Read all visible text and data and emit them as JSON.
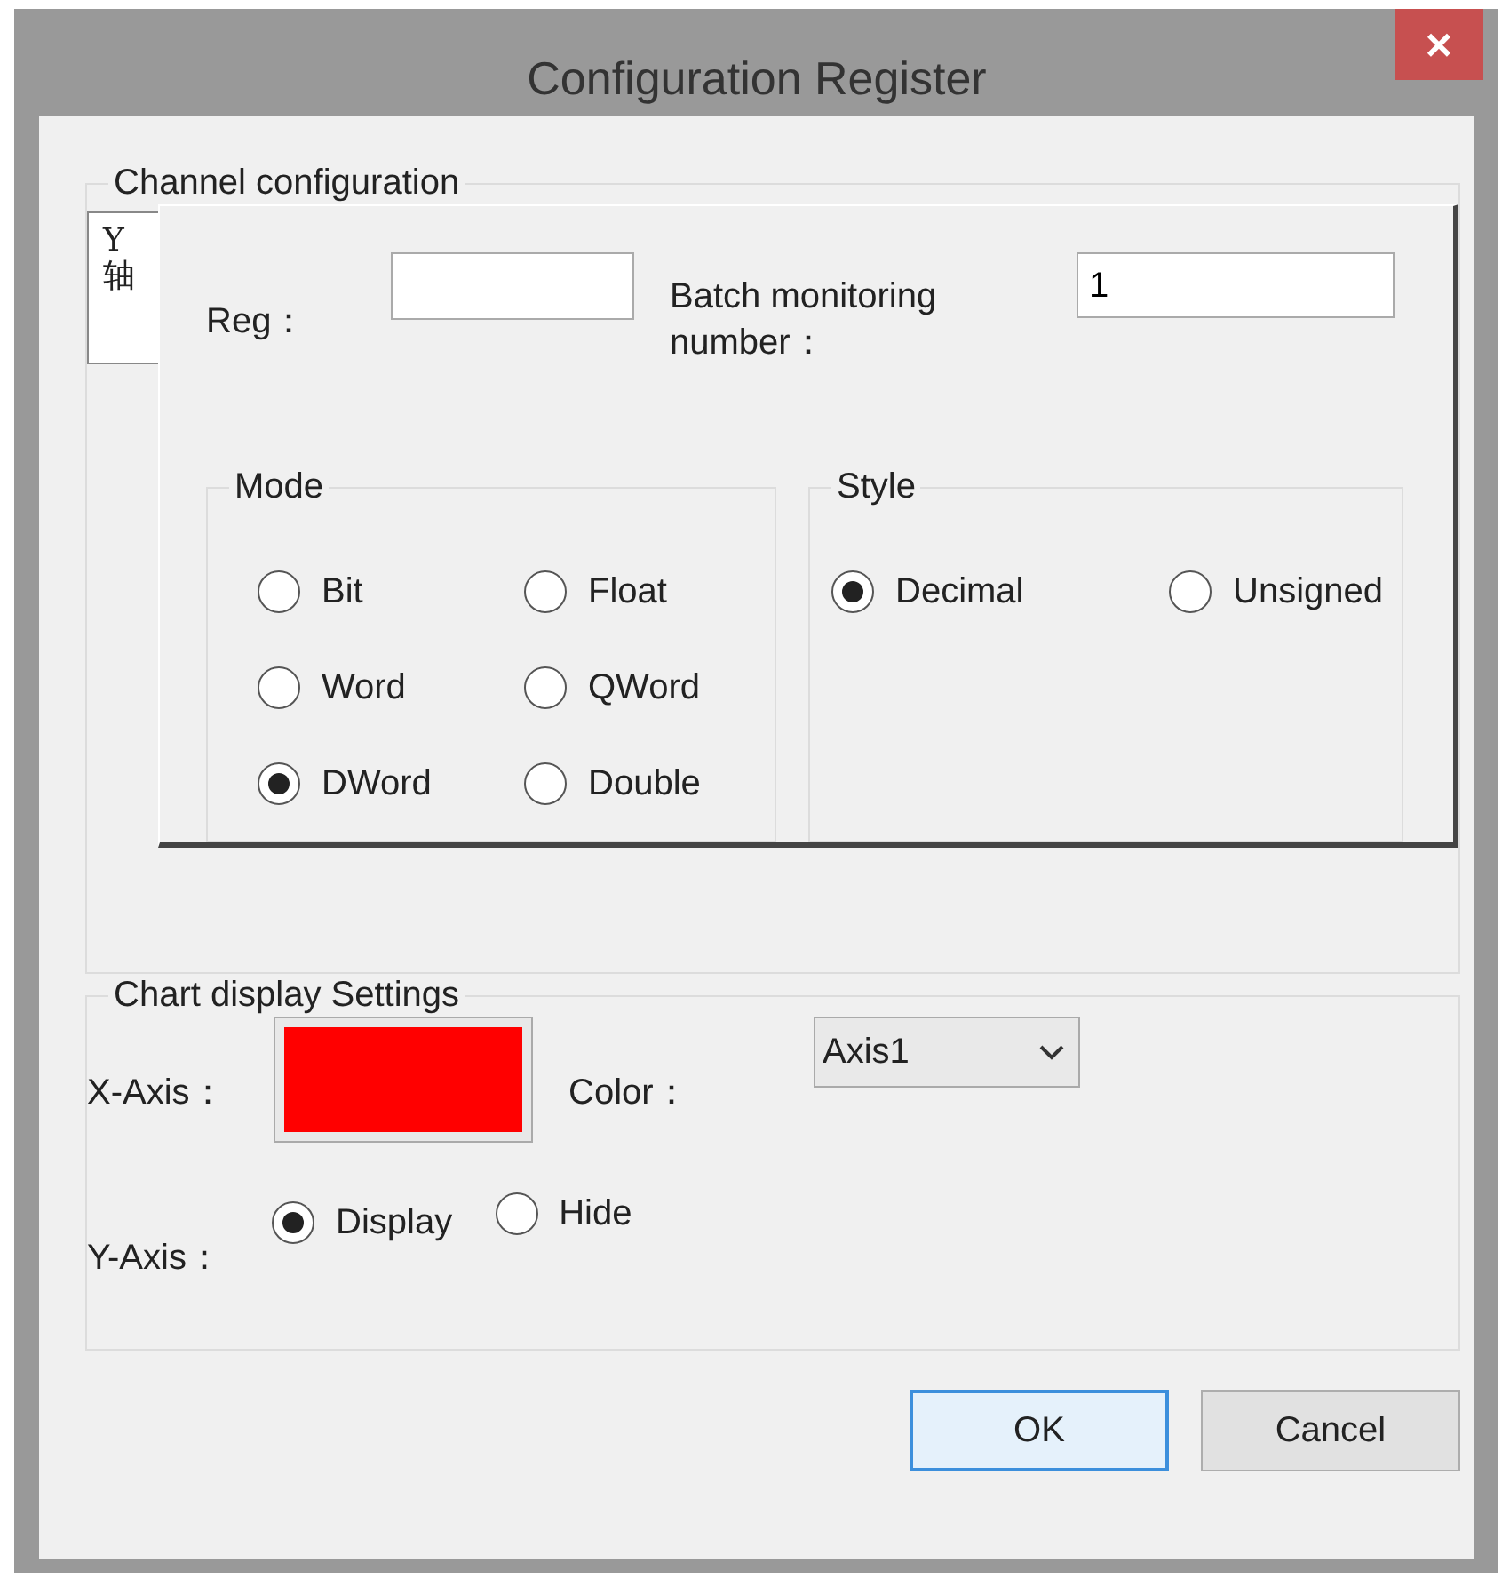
{
  "window": {
    "title": "Configuration Register",
    "close": "×"
  },
  "channel_configuration": {
    "title": "Channel configuration",
    "tabs": [
      {
        "label": "Y轴",
        "selected": true
      }
    ],
    "reg": {
      "label": "Reg："
    },
    "batch_monitoring": {
      "label": "Batch monitoring number：",
      "value": "1"
    },
    "mode": {
      "title": "Mode",
      "options": [
        {
          "label": "Bit",
          "selected": false
        },
        {
          "label": "Float",
          "selected": false
        },
        {
          "label": "Word",
          "selected": false
        },
        {
          "label": "QWord",
          "selected": false
        },
        {
          "label": "DWord",
          "selected": true
        },
        {
          "label": "Double",
          "selected": false
        }
      ]
    },
    "style": {
      "title": "Style",
      "options": [
        {
          "label": "Decimal",
          "selected": true
        },
        {
          "label": "Unsigned",
          "selected": false
        }
      ]
    }
  },
  "chart_display": {
    "title": "Chart display Settings",
    "x_axis": {
      "label": "X-Axis：",
      "color": "#ff0000"
    },
    "color": {
      "label": "Color：",
      "value": "Axis1"
    },
    "y_axis": {
      "label": "Y-Axis：",
      "options": [
        {
          "label": "Display",
          "selected": true
        },
        {
          "label": "Hide",
          "selected": false
        }
      ]
    }
  },
  "buttons": [
    {
      "label": "OK",
      "default": true
    },
    {
      "label": "Cancel",
      "default": false
    }
  ]
}
